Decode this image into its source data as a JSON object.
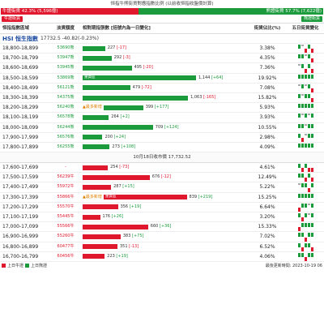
{
  "header": {
    "title": "恒指牛熊街貨對應指數比例 (以前收恒指收盤價計算)",
    "bull_label": "牛證街貨 42.3% (5,596億)",
    "bear_label": "熊證街貨 57.7% (7,622億)"
  },
  "legend": {
    "bull": "牛證街貨",
    "bear": "熊證街貨"
  },
  "columns": {
    "range": "恒指指數區域",
    "lots": "淡貨額度",
    "bar": "相對期指張數 [括號內為一日變化]",
    "pct": "街貨佔比(%)",
    "daily": "五日街貨變化"
  },
  "hsi": {
    "name": "HSI 恒生指數",
    "value": "17732.5 -40.82(-0.23%)"
  },
  "divider": "10月18日收市價 17,732.52",
  "bear_rows": [
    {
      "range": "18,800-18,899",
      "lots": "53690熊",
      "contracts": "227",
      "delta": "-17",
      "pct": "3.38%",
      "value": 227,
      "spark": [
        1,
        0,
        -1,
        1,
        -1
      ]
    },
    {
      "range": "18,700-18,799",
      "lots": "53947熊",
      "contracts": "292",
      "delta": "-3",
      "pct": "4.35%",
      "value": 292,
      "spark": [
        1,
        1,
        0,
        1,
        -1
      ]
    },
    {
      "range": "18,600-18,699",
      "lots": "53945熊",
      "contracts": "495",
      "delta": "-20",
      "pct": "7.36%",
      "value": 495,
      "spark": [
        0,
        1,
        -1,
        1,
        -1
      ]
    },
    {
      "range": "18,500-18,599",
      "lots": "53869熊",
      "contracts": "1,144",
      "delta": "+64",
      "pct": "19.92%",
      "value": 1144,
      "heavy": "重貨區",
      "spark": [
        1,
        1,
        1,
        1,
        1
      ]
    },
    {
      "range": "18,400-18,499",
      "lots": "56121熊",
      "contracts": "479",
      "delta": "-72",
      "pct": "7.08%",
      "value": 479,
      "spark": [
        0,
        1,
        0,
        1,
        -1
      ]
    },
    {
      "range": "18,300-18,399",
      "lots": "54375熊",
      "contracts": "1,063",
      "delta": "-165",
      "pct": "15.82%",
      "value": 1063,
      "spark": [
        1,
        0,
        1,
        1,
        -1
      ]
    },
    {
      "range": "18,200-18,299",
      "lots": "56240熊",
      "contracts": "399",
      "delta": "+177",
      "pct": "5.93%",
      "value": 399,
      "flag": "最多新增",
      "spark": [
        1,
        1,
        1,
        1,
        1
      ]
    },
    {
      "range": "18,100-18,199",
      "lots": "56578熊",
      "contracts": "264",
      "delta": "+2",
      "pct": "3.93%",
      "value": 264,
      "spark": [
        1,
        0,
        1,
        0,
        1
      ]
    },
    {
      "range": "18,000-18,099",
      "lots": "56244熊",
      "contracts": "709",
      "delta": "+124",
      "pct": "10.55%",
      "value": 709,
      "spark": [
        1,
        1,
        0,
        1,
        1
      ]
    },
    {
      "range": "17,900-17,999",
      "lots": "56576熊",
      "contracts": "200",
      "delta": "+24",
      "pct": "2.98%",
      "value": 200,
      "spark": [
        1,
        -1,
        0,
        1,
        1
      ]
    },
    {
      "range": "17,800-17,899",
      "lots": "56255熊",
      "contracts": "273",
      "delta": "+108",
      "pct": "4.09%",
      "value": 273,
      "spark": [
        1,
        1,
        1,
        1,
        1
      ]
    }
  ],
  "bull_rows": [
    {
      "range": "17,600-17,699",
      "lots": "-",
      "contracts": "254",
      "delta": "-73",
      "pct": "4.61%",
      "value": 254,
      "spark": [
        1,
        -1,
        1,
        -1,
        -1
      ]
    },
    {
      "range": "17,500-17,599",
      "lots": "56239牛",
      "contracts": "676",
      "delta": "-12",
      "pct": "12.49%",
      "value": 676,
      "spark": [
        1,
        1,
        -1,
        1,
        -1
      ]
    },
    {
      "range": "17,400-17,499",
      "lots": "55972牛",
      "contracts": "287",
      "delta": "+15",
      "pct": "5.22%",
      "value": 287,
      "spark": [
        0,
        1,
        1,
        -1,
        1
      ]
    },
    {
      "range": "17,300-17,399",
      "lots": "55866牛",
      "contracts": "839",
      "delta": "+219",
      "pct": "15.25%",
      "value": 839,
      "heavy": "重貨區",
      "flag": "最多新增",
      "spark": [
        1,
        1,
        1,
        1,
        1
      ]
    },
    {
      "range": "17,200-17,299",
      "lots": "55570牛",
      "contracts": "356",
      "delta": "+19",
      "pct": "6.64%",
      "value": 356,
      "spark": [
        -1,
        1,
        1,
        0,
        1
      ]
    },
    {
      "range": "17,100-17,199",
      "lots": "55445牛",
      "contracts": "176",
      "delta": "+26",
      "pct": "3.20%",
      "value": 176,
      "spark": [
        1,
        -1,
        1,
        0,
        1
      ]
    },
    {
      "range": "17,000-17,099",
      "lots": "55566牛",
      "contracts": "660",
      "delta": "+36",
      "pct": "15.33%",
      "value": 660,
      "spark": [
        -1,
        1,
        1,
        1,
        1
      ]
    },
    {
      "range": "16,900-16,999",
      "lots": "55260牛",
      "contracts": "383",
      "delta": "+75",
      "pct": "7.02%",
      "value": 383,
      "spark": [
        1,
        1,
        -1,
        1,
        1
      ]
    },
    {
      "range": "16,800-16,899",
      "lots": "60477牛",
      "contracts": "351",
      "delta": "-13",
      "pct": "6.52%",
      "value": 351,
      "spark": [
        1,
        -1,
        1,
        1,
        -1
      ]
    },
    {
      "range": "16,700-16,799",
      "lots": "60456牛",
      "contracts": "223",
      "delta": "+19",
      "pct": "4.06%",
      "value": 223,
      "spark": [
        1,
        1,
        -1,
        1,
        1
      ]
    }
  ],
  "footer": {
    "bull": "上日牛證",
    "bear": "上日熊證",
    "updated": "最後更新時間: 2023-10-19 06"
  },
  "colors": {
    "bull": "#e0182d",
    "bear": "#1b9b3c"
  },
  "max_value": 1144
}
